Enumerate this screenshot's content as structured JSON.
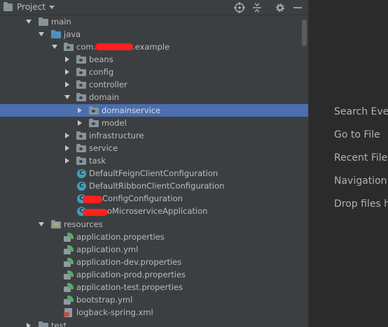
{
  "header": {
    "title": "Project",
    "icons": [
      "chevron-down-icon",
      "locate-icon",
      "collapse-all-icon",
      "gear-icon",
      "hide-icon"
    ]
  },
  "tree": [
    {
      "label": "main",
      "icon": "folder",
      "expanded": true
    },
    {
      "label": "java",
      "icon": "folder-source",
      "expanded": true
    },
    {
      "label": "com.",
      "label_suffix": ".example",
      "icon": "package",
      "expanded": true
    },
    {
      "label": "beans",
      "icon": "package",
      "expanded": false
    },
    {
      "label": "config",
      "icon": "package",
      "expanded": false
    },
    {
      "label": "controller",
      "icon": "package",
      "expanded": false
    },
    {
      "label": "domain",
      "icon": "package",
      "expanded": true
    },
    {
      "label": "domainservice",
      "icon": "package",
      "expanded": false,
      "selected": true
    },
    {
      "label": "model",
      "icon": "package",
      "expanded": false
    },
    {
      "label": "infrastructure",
      "icon": "package",
      "expanded": false
    },
    {
      "label": "service",
      "icon": "package",
      "expanded": false
    },
    {
      "label": "task",
      "icon": "package",
      "expanded": false
    },
    {
      "label": "DefaultFeignClientConfiguration",
      "icon": "class"
    },
    {
      "label": "DefaultRibbonClientConfiguration",
      "icon": "class"
    },
    {
      "label": "ConfigConfiguration",
      "icon": "class"
    },
    {
      "label": "oMicroserviceApplication",
      "icon": "spring-boot-class"
    },
    {
      "label": "resources",
      "icon": "folder-resources",
      "expanded": true
    },
    {
      "label": "application.properties",
      "icon": "spring-config-file"
    },
    {
      "label": "application.yml",
      "icon": "spring-config-file"
    },
    {
      "label": "application-dev.properties",
      "icon": "spring-config-file"
    },
    {
      "label": "application-prod.properties",
      "icon": "spring-config-file"
    },
    {
      "label": "application-test.properties",
      "icon": "spring-config-file"
    },
    {
      "label": "bootstrap.yml",
      "icon": "spring-config-file"
    },
    {
      "label": "logback-spring.xml",
      "icon": "xml-file"
    },
    {
      "label": "test",
      "icon": "folder",
      "expanded": false
    }
  ],
  "editor_hints": [
    "Search Eve",
    "Go to File",
    "Recent File",
    "Navigation",
    "Drop files h"
  ],
  "colors": {
    "panel_bg": "#3c3f41",
    "editor_bg": "#2b2b2b",
    "selection": "#4b6eaf",
    "text": "#bbbbbb",
    "redaction": "#ff1f1f"
  }
}
